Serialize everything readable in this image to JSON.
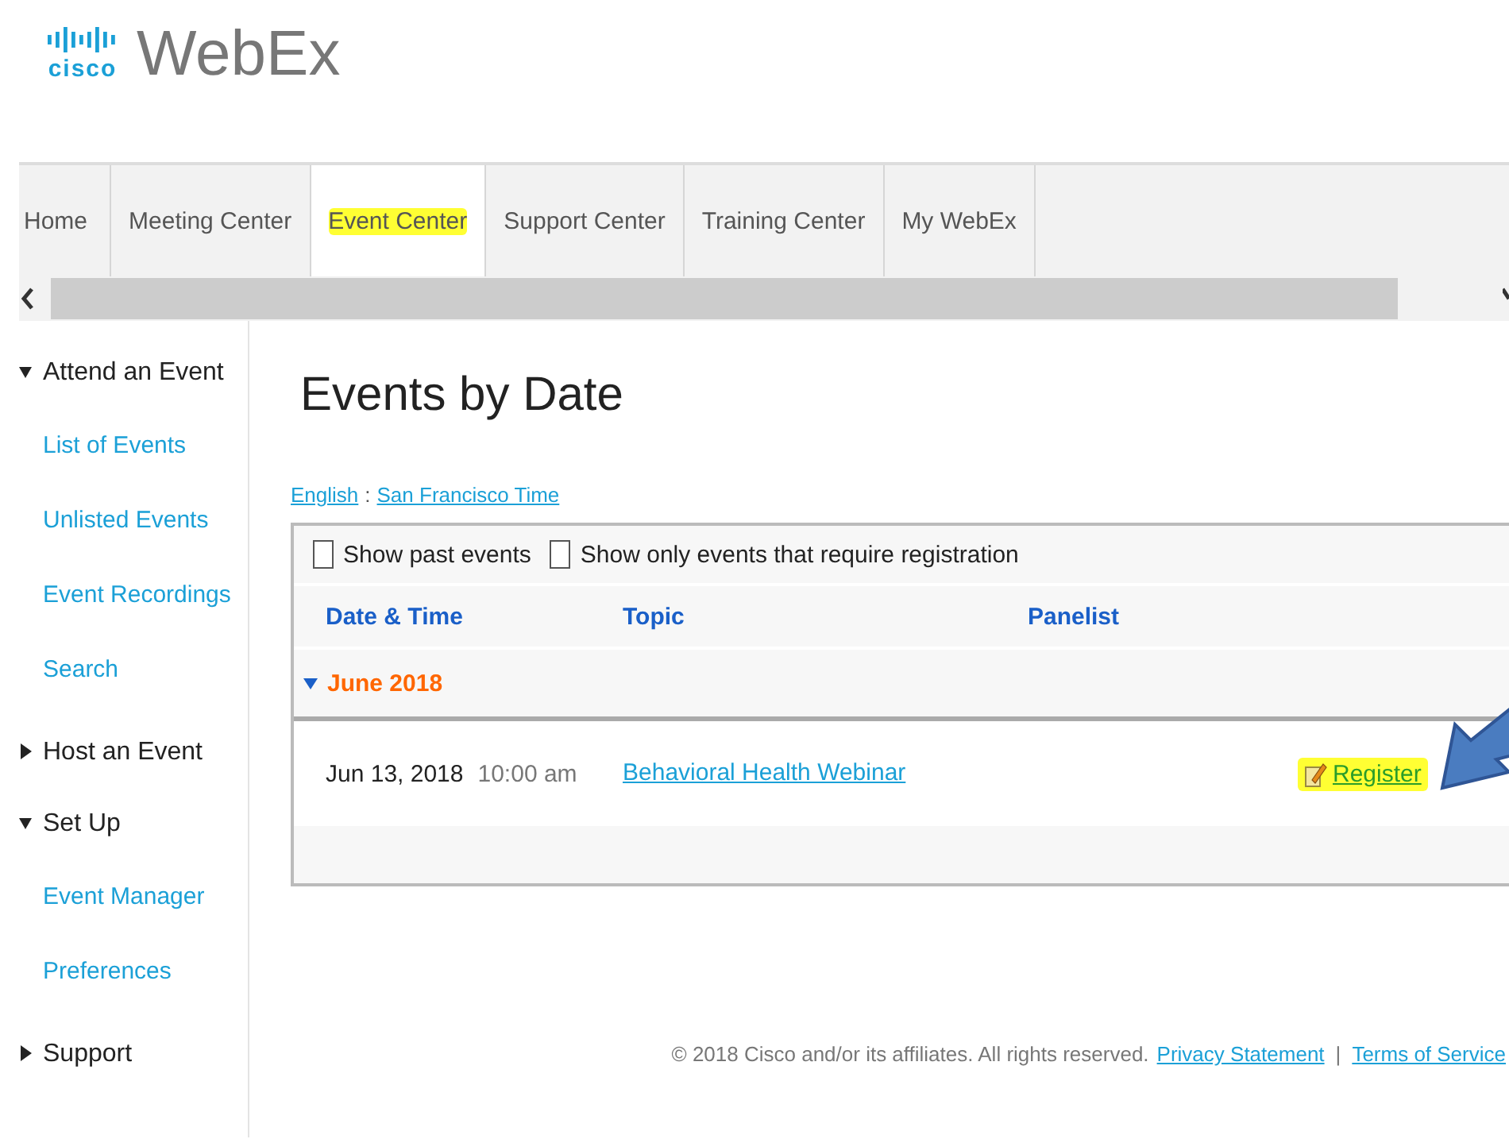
{
  "logo": {
    "brand": "cisco",
    "product": "WebEx"
  },
  "nav_tabs": [
    {
      "label": "Home",
      "selected": false,
      "highlighted": false
    },
    {
      "label": "Meeting Center",
      "selected": false,
      "highlighted": false
    },
    {
      "label": "Event Center",
      "selected": true,
      "highlighted": true
    },
    {
      "label": "Support Center",
      "selected": false,
      "highlighted": false
    },
    {
      "label": "Training Center",
      "selected": false,
      "highlighted": false
    },
    {
      "label": "My WebEx",
      "selected": false,
      "highlighted": false
    }
  ],
  "sidebar": [
    {
      "label": "Attend an Event",
      "expanded": true,
      "children": [
        {
          "label": "List of Events"
        },
        {
          "label": "Unlisted Events"
        },
        {
          "label": "Event Recordings"
        },
        {
          "label": "Search"
        }
      ]
    },
    {
      "label": "Host an Event",
      "expanded": false
    },
    {
      "label": "Set Up",
      "expanded": true,
      "children": [
        {
          "label": "Event Manager"
        },
        {
          "label": "Preferences"
        }
      ]
    },
    {
      "label": "Support",
      "expanded": false
    }
  ],
  "main": {
    "title": "Events by Date",
    "language": "English",
    "separator": ":",
    "timezone": "San Francisco Time",
    "filters": [
      {
        "label": "Show past events",
        "checked": false
      },
      {
        "label": "Show only events that require registration",
        "checked": false
      }
    ],
    "columns": [
      "Date & Time",
      "Topic",
      "Panelist"
    ],
    "groups": [
      {
        "label": "June 2018",
        "expanded": true,
        "events": [
          {
            "date": "Jun 13, 2018",
            "time": "10:00 am",
            "topic": "Behavioral Health Webinar",
            "action": "Register",
            "highlighted": true
          }
        ]
      }
    ]
  },
  "footer": {
    "copyright": "© 2018 Cisco and/or its affiliates. All rights reserved.",
    "links": [
      "Privacy Statement",
      "Terms of Service"
    ],
    "separator": "|"
  }
}
